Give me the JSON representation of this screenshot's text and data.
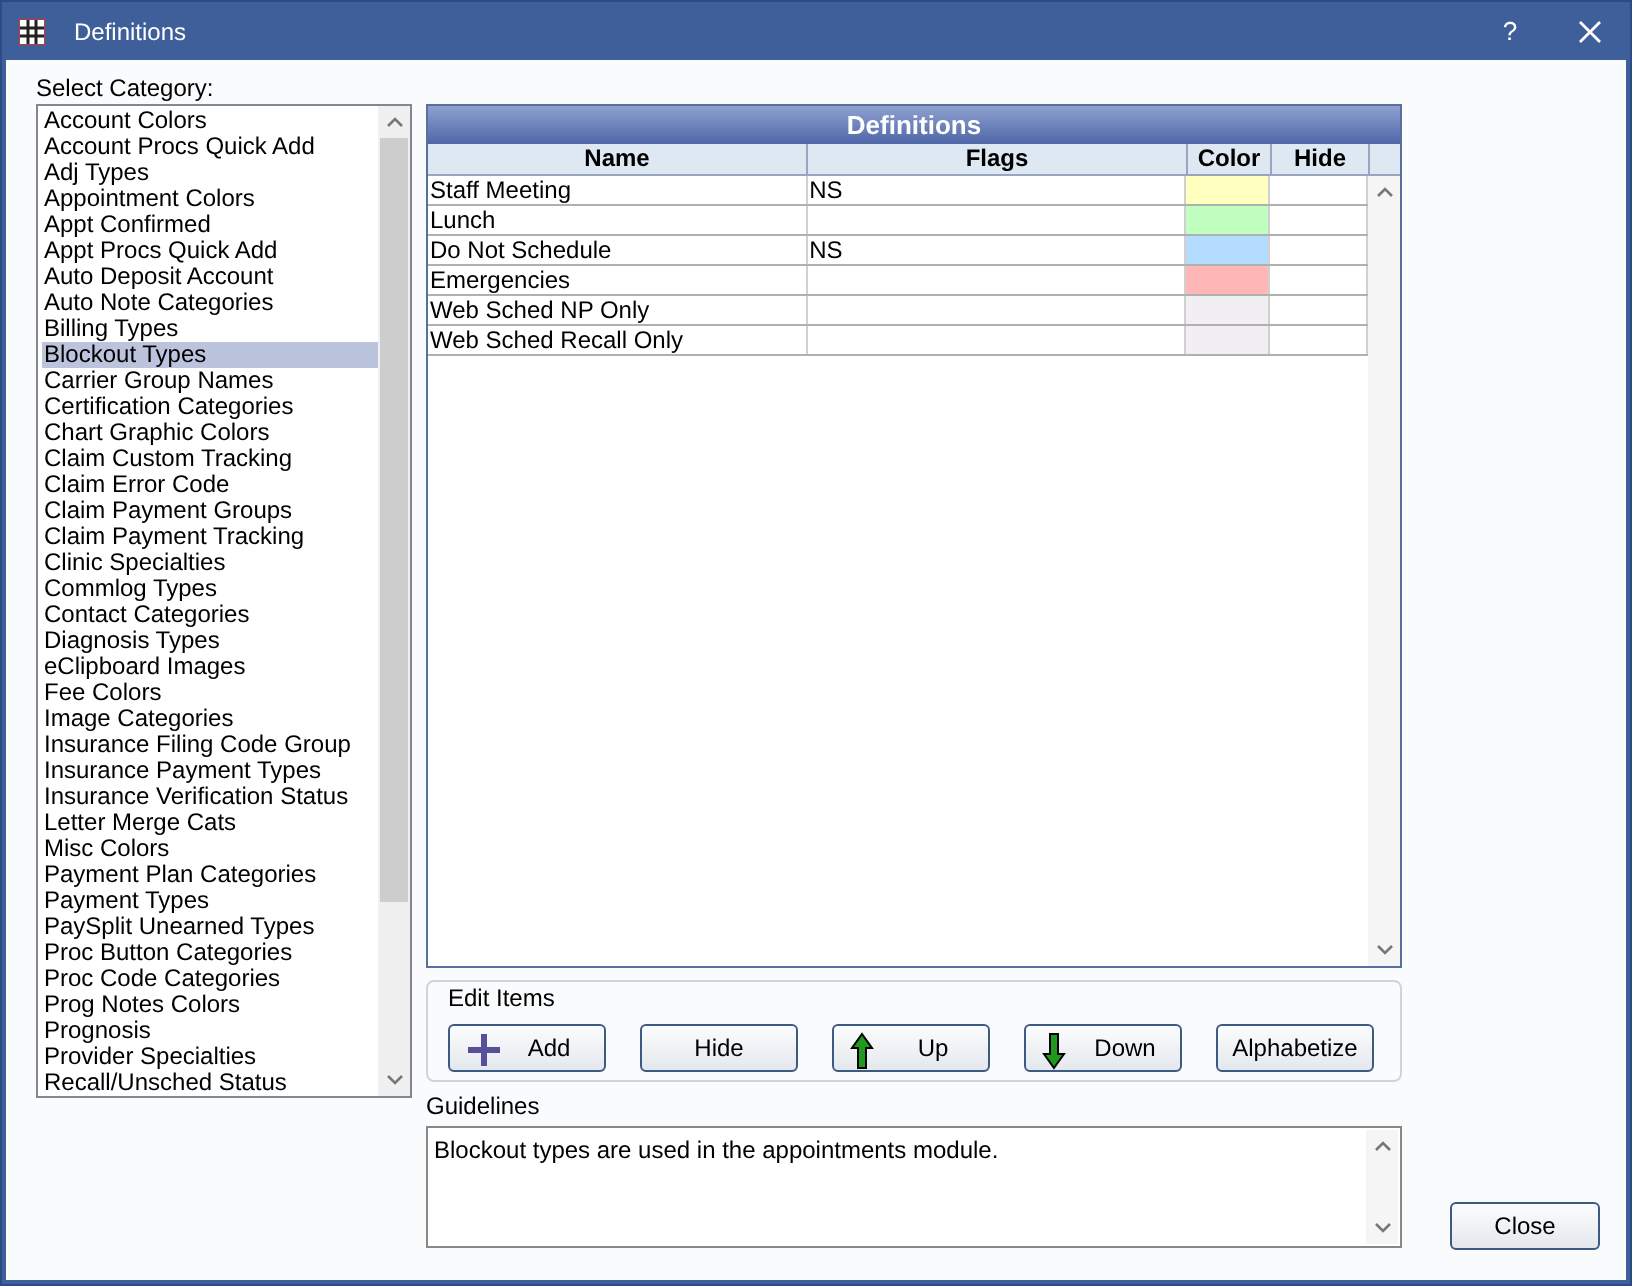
{
  "window": {
    "title": "Definitions",
    "help": "?"
  },
  "category_label": "Select Category:",
  "categories": [
    {
      "label": "Account Colors",
      "selected": false
    },
    {
      "label": "Account Procs Quick Add",
      "selected": false
    },
    {
      "label": "Adj Types",
      "selected": false
    },
    {
      "label": "Appointment Colors",
      "selected": false
    },
    {
      "label": "Appt Confirmed",
      "selected": false
    },
    {
      "label": "Appt Procs Quick Add",
      "selected": false
    },
    {
      "label": "Auto Deposit Account",
      "selected": false
    },
    {
      "label": "Auto Note Categories",
      "selected": false
    },
    {
      "label": "Billing Types",
      "selected": false
    },
    {
      "label": "Blockout Types",
      "selected": true
    },
    {
      "label": "Carrier Group Names",
      "selected": false
    },
    {
      "label": "Certification Categories",
      "selected": false
    },
    {
      "label": "Chart Graphic Colors",
      "selected": false
    },
    {
      "label": "Claim Custom Tracking",
      "selected": false
    },
    {
      "label": "Claim Error Code",
      "selected": false
    },
    {
      "label": "Claim Payment Groups",
      "selected": false
    },
    {
      "label": "Claim Payment Tracking",
      "selected": false
    },
    {
      "label": "Clinic Specialties",
      "selected": false
    },
    {
      "label": "Commlog Types",
      "selected": false
    },
    {
      "label": "Contact Categories",
      "selected": false
    },
    {
      "label": "Diagnosis Types",
      "selected": false
    },
    {
      "label": "eClipboard Images",
      "selected": false
    },
    {
      "label": "Fee Colors",
      "selected": false
    },
    {
      "label": "Image Categories",
      "selected": false
    },
    {
      "label": "Insurance Filing Code Group",
      "selected": false
    },
    {
      "label": "Insurance Payment Types",
      "selected": false
    },
    {
      "label": "Insurance Verification Status",
      "selected": false
    },
    {
      "label": "Letter Merge Cats",
      "selected": false
    },
    {
      "label": "Misc Colors",
      "selected": false
    },
    {
      "label": "Payment Plan Categories",
      "selected": false
    },
    {
      "label": "Payment Types",
      "selected": false
    },
    {
      "label": "PaySplit Unearned Types",
      "selected": false
    },
    {
      "label": "Proc Button Categories",
      "selected": false
    },
    {
      "label": "Proc Code Categories",
      "selected": false
    },
    {
      "label": "Prog Notes Colors",
      "selected": false
    },
    {
      "label": "Prognosis",
      "selected": false
    },
    {
      "label": "Provider Specialties",
      "selected": false
    },
    {
      "label": "Recall/Unsched Status",
      "selected": false
    }
  ],
  "table": {
    "title": "Definitions",
    "columns": [
      "Name",
      "Flags",
      "Color",
      "Hide"
    ],
    "rows": [
      {
        "name": "Staff Meeting",
        "flags": "NS",
        "color": "#ffffc0"
      },
      {
        "name": "Lunch",
        "color": "#c0ffc0"
      },
      {
        "name": "Do Not Schedule",
        "flags": "NS",
        "color": "#b4dcff"
      },
      {
        "name": "Emergencies",
        "color": "#ffb6b6"
      },
      {
        "name": "Web Sched NP Only",
        "color": "#f1eff2"
      },
      {
        "name": "Web Sched Recall Only",
        "color": "#f1eff2"
      }
    ]
  },
  "edit_items": {
    "label": "Edit Items",
    "buttons": [
      {
        "label": "Add",
        "kind": "add"
      },
      {
        "label": "Hide",
        "kind": "plain"
      },
      {
        "label": "Up",
        "kind": "up"
      },
      {
        "label": "Down",
        "kind": "down"
      },
      {
        "label": "Alphabetize",
        "kind": "plain"
      }
    ]
  },
  "guidelines": {
    "label": "Guidelines",
    "text": "Blockout types are used in the appointments module."
  },
  "close_button": "Close"
}
